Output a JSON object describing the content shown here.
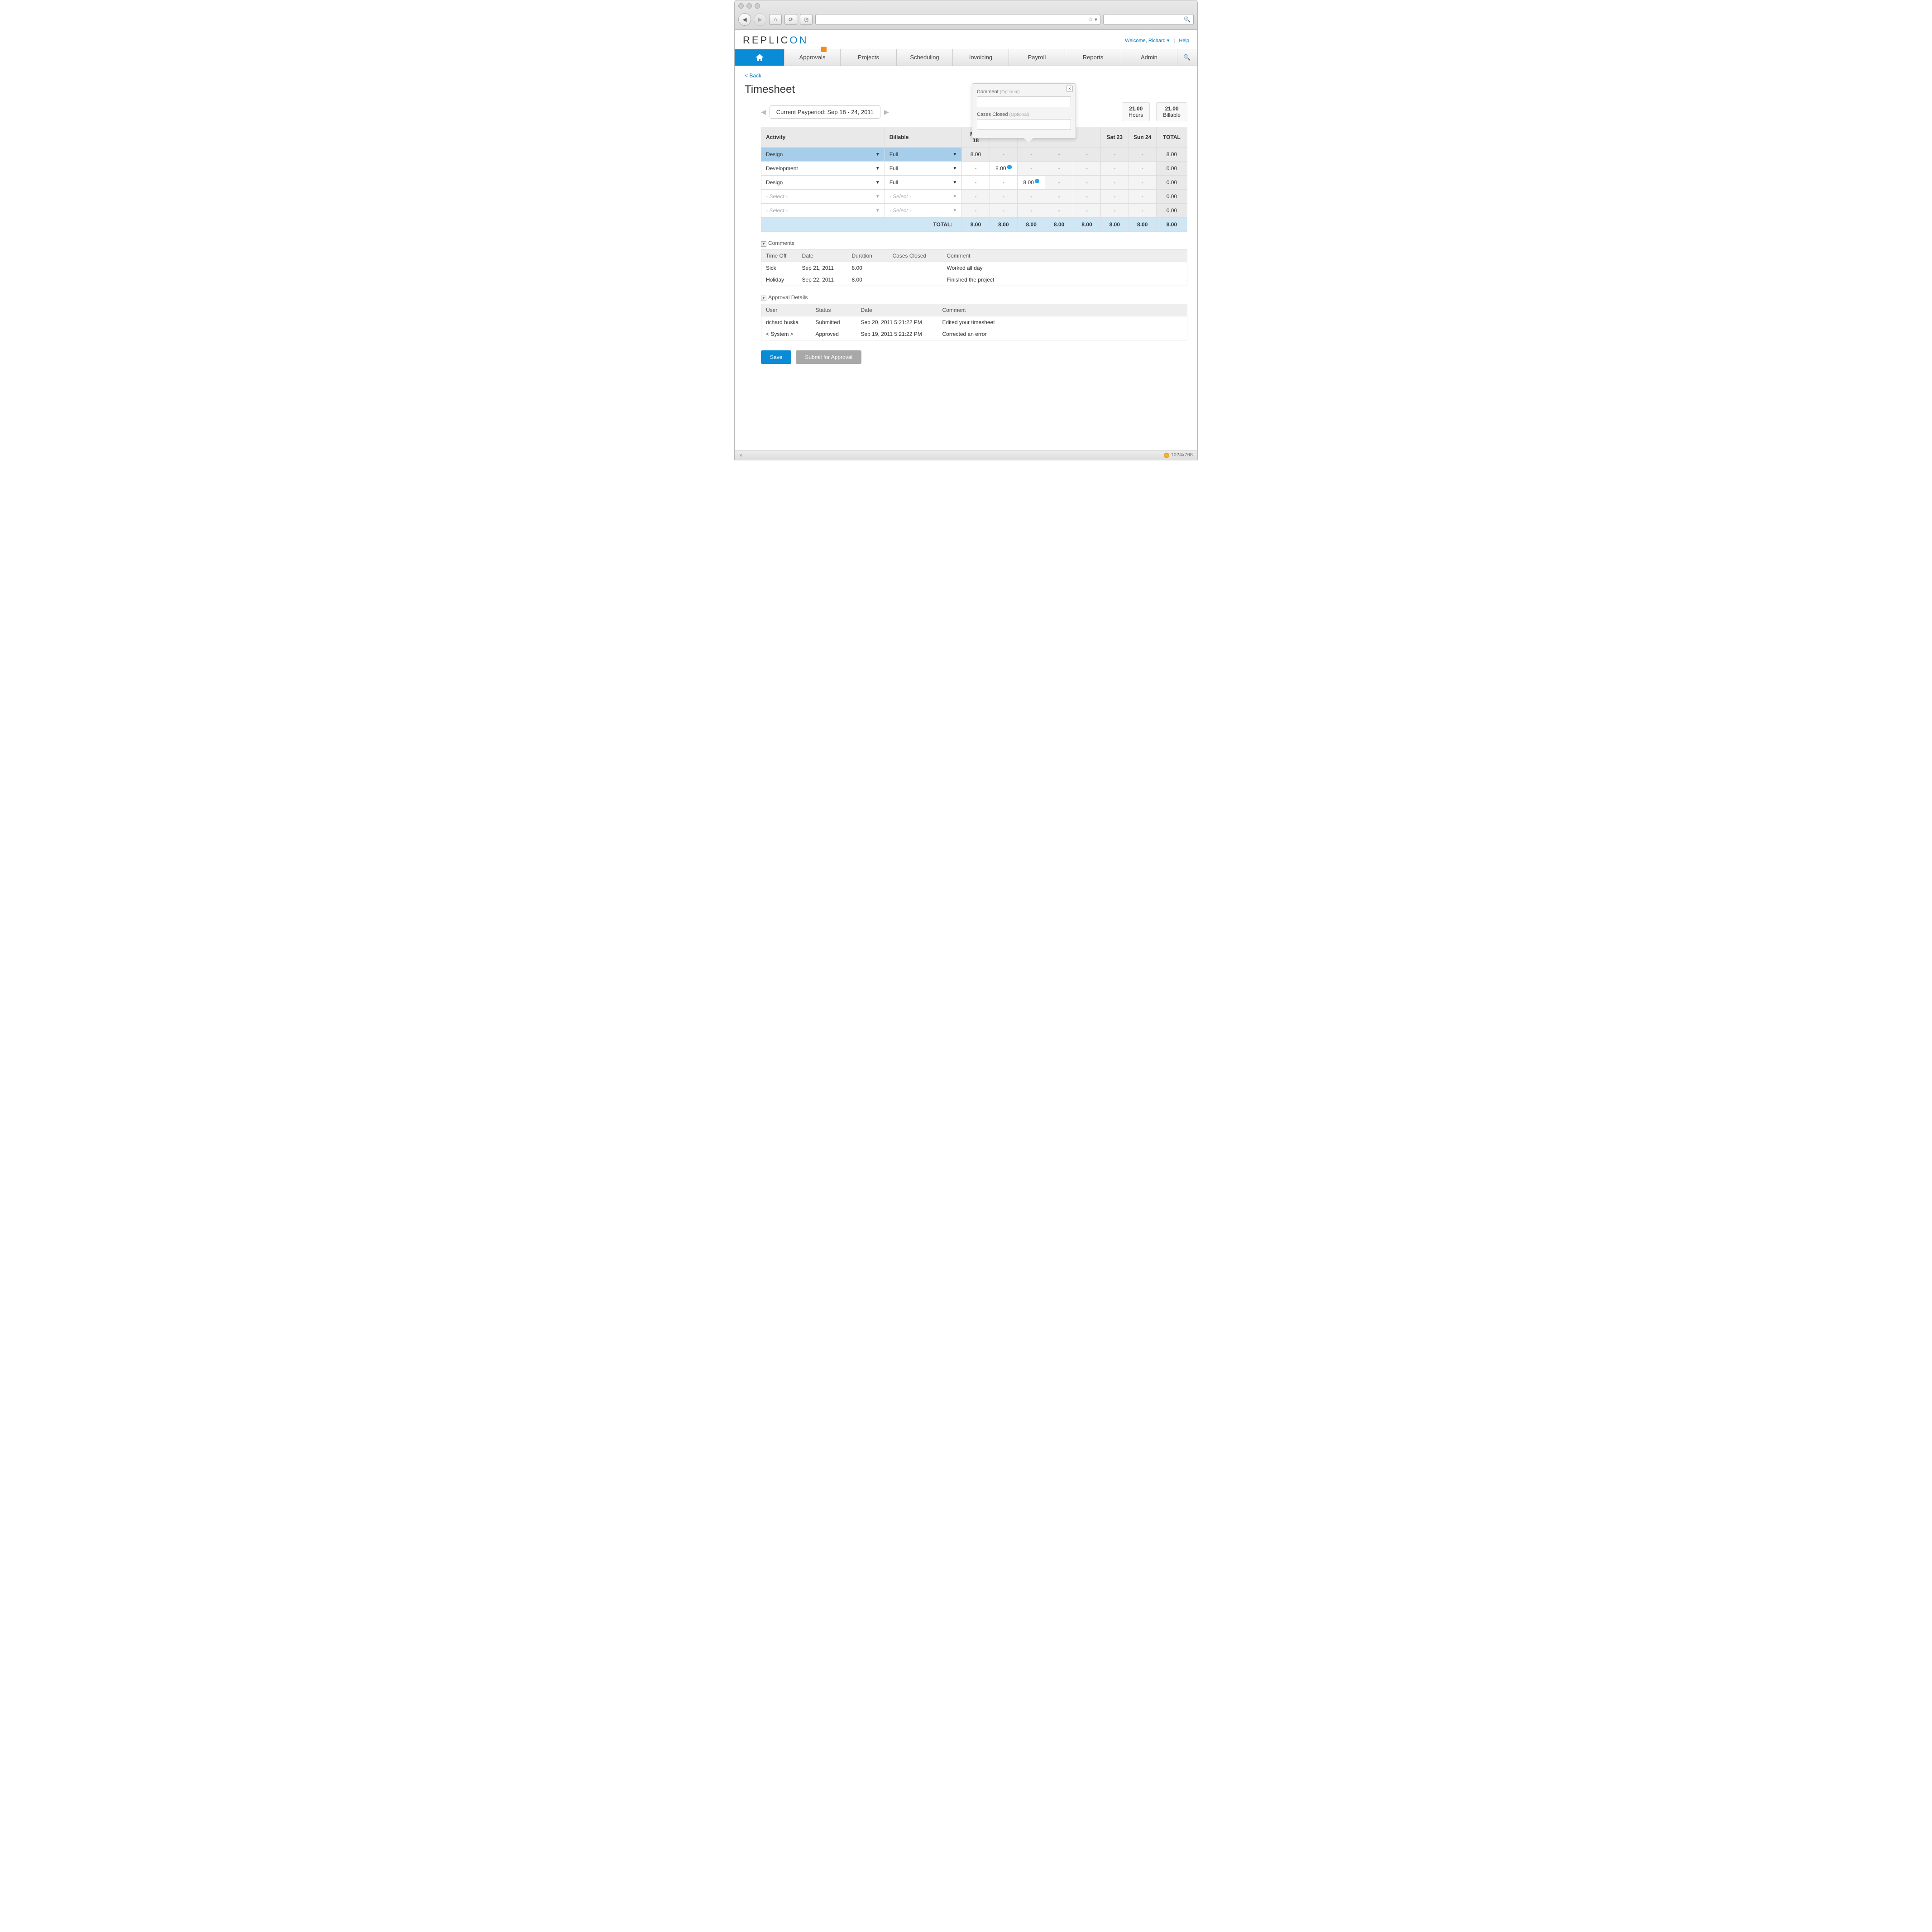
{
  "header": {
    "logo_a": "REPLIC",
    "logo_b": "ON",
    "welcome": "Welcome, Richard",
    "help": "Help"
  },
  "tabs": [
    "Approvals",
    "Projects",
    "Scheduling",
    "Invoicing",
    "Payroll",
    "Reports",
    "Admin"
  ],
  "page": {
    "back": "< Back",
    "title": "Timesheet",
    "payperiod": "Current Payperiod: Sep 18 - 24, 2011",
    "totals": {
      "hours_val": "21.00",
      "hours_lbl": "Hours",
      "bill_val": "21.00",
      "bill_lbl": "Billable"
    }
  },
  "grid": {
    "cols": {
      "activity": "Activity",
      "billable": "Billable",
      "total": "TOTAL"
    },
    "days": [
      "Mon 18",
      "",
      "",
      "",
      "",
      "Sat 23",
      "Sun 24"
    ],
    "rows": [
      {
        "activity": "Design",
        "billable": "Full",
        "cells": [
          "8.00",
          "-",
          "-",
          "-",
          "-",
          "-",
          "-"
        ],
        "total": "8.00",
        "selected": true,
        "white": [
          0
        ]
      },
      {
        "activity": "Development",
        "billable": "Full",
        "cells": [
          "-",
          "8.00",
          "-",
          "-",
          "-",
          "-",
          "-"
        ],
        "total": "0.00",
        "white": [
          0,
          1
        ],
        "bubble": [
          1
        ]
      },
      {
        "activity": "Design",
        "billable": "Full",
        "cells": [
          "-",
          "-",
          "8.00",
          "-",
          "-",
          "-",
          "-"
        ],
        "total": "0.00",
        "white": [
          0,
          1,
          2
        ],
        "bubble": [
          2
        ]
      },
      {
        "activity": "- Select -",
        "billable": "- Select -",
        "cells": [
          "-",
          "-",
          "-",
          "-",
          "-",
          "-",
          "-"
        ],
        "total": "0.00",
        "placeholder": true
      },
      {
        "activity": "- Select -",
        "billable": "- Select -",
        "cells": [
          "-",
          "-",
          "-",
          "-",
          "-",
          "-",
          "-"
        ],
        "total": "0.00",
        "placeholder": true
      }
    ],
    "total_label": "TOTAL:",
    "total_cells": [
      "8.00",
      "8.00",
      "8.00",
      "8.00",
      "8.00",
      "8.00",
      "8.00",
      "8.00"
    ]
  },
  "popover": {
    "comment_lbl": "Comment",
    "cases_lbl": "Cases Closed",
    "optional": "(Optional)"
  },
  "comments": {
    "title": "Comments",
    "cols": [
      "Time Off",
      "Date",
      "Duration",
      "Cases Closed",
      "Comment"
    ],
    "rows": [
      [
        "Sick",
        "Sep 21, 2011",
        "8.00",
        "",
        "Worked all day"
      ],
      [
        "Holiday",
        "Sep 22, 2011",
        "8.00",
        "",
        "Finished the project"
      ]
    ]
  },
  "approval": {
    "title": "Approval Details",
    "cols": [
      "User",
      "Status",
      "Date",
      "Comment"
    ],
    "rows": [
      [
        "richard huska",
        "Submitted",
        "Sep 20, 2011  5:21:22 PM",
        "Edited your timesheet"
      ],
      [
        "< System >",
        "Approved",
        "Sep 19, 2011  5:21:22 PM",
        "Corrected an error"
      ]
    ]
  },
  "buttons": {
    "save": "Save",
    "submit": "Submit for Approval"
  },
  "statusbar": {
    "dims": "1024x768"
  }
}
